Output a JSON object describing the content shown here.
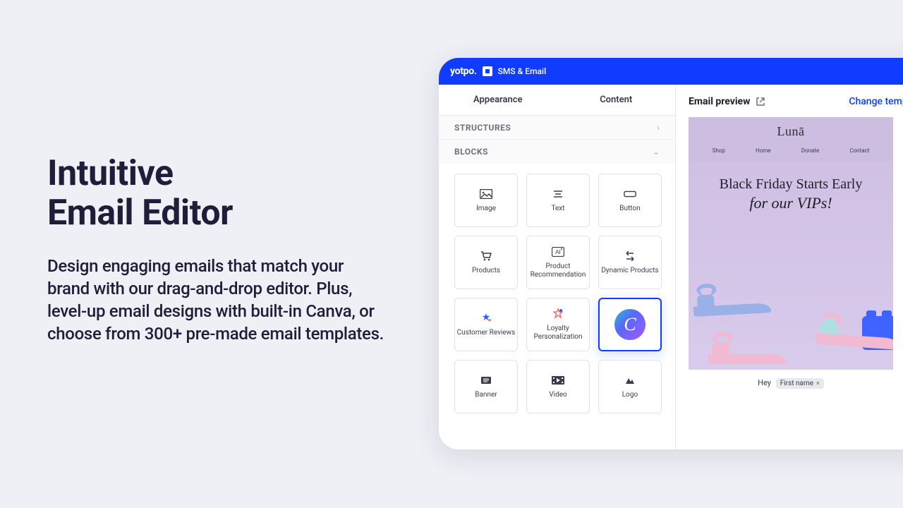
{
  "marketing": {
    "heading_l1": "Intuitive",
    "heading_l2": "Email Editor",
    "body": "Design engaging emails that match your brand with our drag-and-drop editor. Plus, level-up email designs with built-in Canva, or choose from 300+ pre-made email templates."
  },
  "header": {
    "brand": "yotpo.",
    "product": "SMS & Email"
  },
  "tabs": {
    "appearance": "Appearance",
    "content": "Content"
  },
  "sections": {
    "structures": "STRUCTURES",
    "blocks": "BLOCKS"
  },
  "blocks": {
    "image": "Image",
    "text": "Text",
    "button": "Button",
    "products": "Products",
    "product_recommendation": "Product Recommendation",
    "dynamic_products": "Dynamic Products",
    "customer_reviews": "Customer Reviews",
    "loyalty_personalization": "Loyalty Personalization",
    "canva_glyph": "C",
    "banner": "Banner",
    "video": "Video",
    "logo": "Logo"
  },
  "preview": {
    "title": "Email preview",
    "change": "Change template"
  },
  "email": {
    "brand": "Lunā",
    "nav": {
      "shop": "Shop",
      "home": "Home",
      "donate": "Donate",
      "contact": "Contact"
    },
    "hero_line1": "Black Friday Starts Early",
    "hero_line2": "for our VIPs!",
    "greeting": "Hey",
    "token": "First name",
    "token_close": "×"
  }
}
